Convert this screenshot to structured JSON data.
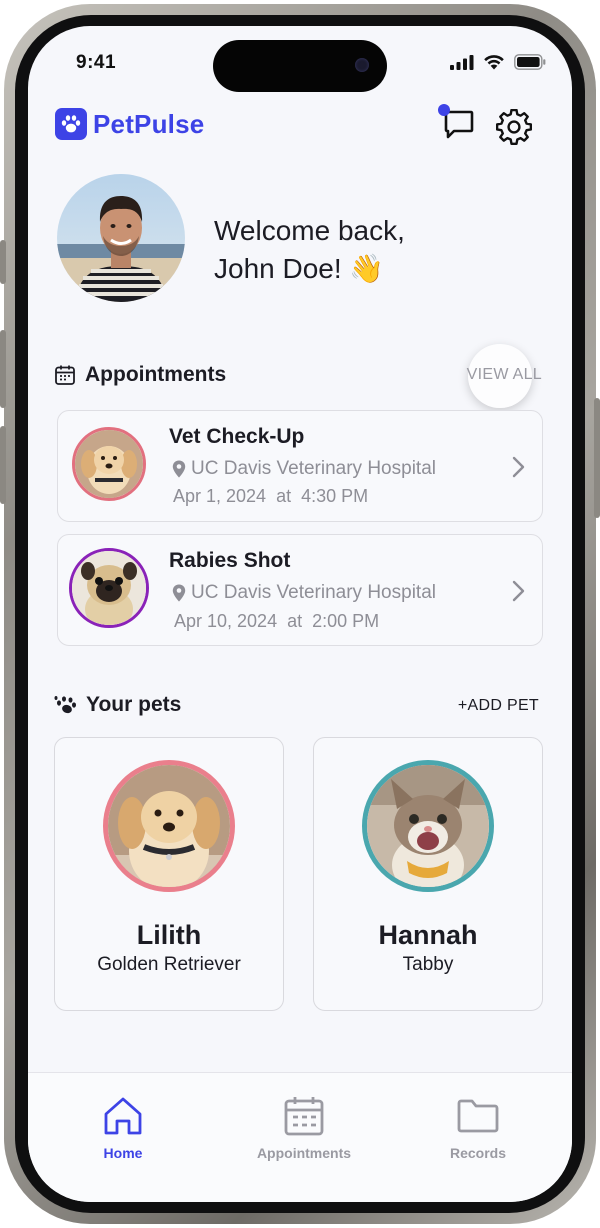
{
  "status_bar": {
    "time": "9:41"
  },
  "header": {
    "app_name": "PetPulse",
    "brand_color": "#3d43e6"
  },
  "welcome": {
    "line1": "Welcome back,",
    "line2": "John Doe! 👋"
  },
  "appointments": {
    "title": "Appointments",
    "view_all_label": "VIEW ALL",
    "items": [
      {
        "title": "Vet Check-Up",
        "location": "UC Davis Veterinary Hospital",
        "date": "Apr 1, 2024",
        "at": "at",
        "time": "4:30 PM",
        "ring_color": "#e2707f",
        "pet": "golden retriever puppy"
      },
      {
        "title": "Rabies Shot",
        "location": "UC Davis Veterinary Hospital",
        "date": "Apr 10, 2024",
        "at": "at",
        "time": "2:00 PM",
        "ring_color": "#8a22b8",
        "pet": "pug"
      }
    ]
  },
  "pets": {
    "title": "Your pets",
    "add_label": "+ADD PET",
    "items": [
      {
        "name": "Lilith",
        "breed": "Golden Retriever",
        "ring_color": "#ea7f8c"
      },
      {
        "name": "Hannah",
        "breed": "Tabby",
        "ring_color": "#4aa7ae"
      }
    ]
  },
  "tabbar": {
    "items": [
      {
        "label": "Home",
        "icon": "home-icon",
        "active": true
      },
      {
        "label": "Appointments",
        "icon": "calendar-icon",
        "active": false
      },
      {
        "label": "Records",
        "icon": "folder-icon",
        "active": false
      }
    ]
  }
}
